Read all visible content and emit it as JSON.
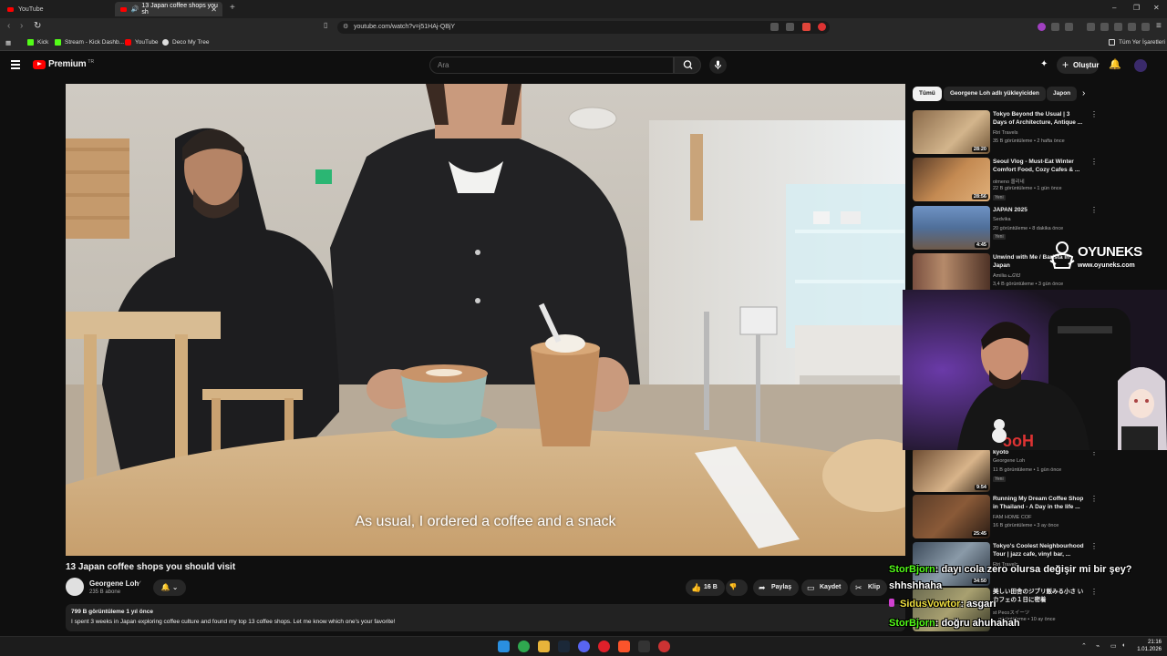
{
  "browser": {
    "tabs": [
      {
        "label": "YouTube"
      },
      {
        "label": "13 Japan coffee shops you sh"
      }
    ],
    "new_tab": "+",
    "window_controls": {
      "minimize": "–",
      "maximize": "❐",
      "close": "✕"
    },
    "url": "youtube.com/watch?v=j51HAj-QBjY",
    "bookmarks": [
      {
        "label": "Kick",
        "color": "#53fc18"
      },
      {
        "label": "Stream - Kick Dashb...",
        "color": "#53fc18"
      },
      {
        "label": "YouTube",
        "color": "#ff0000"
      },
      {
        "label": "Deco My Tree",
        "color": "#dddddd"
      }
    ],
    "all_bookmarks": "Tüm Yer İşaretleri"
  },
  "youtube": {
    "logo_text": "Premium",
    "logo_region": "TR",
    "search_placeholder": "Ara",
    "create_label": "Oluştur",
    "create_icon": "+"
  },
  "video": {
    "subtitle": "As usual, I ordered a coffee and a snack",
    "title": "13 Japan coffee shops you should visit",
    "channel": "Georgene Loh",
    "verified_icon": "✓",
    "subscribers": "235 B abone",
    "bell": "🔔 ⌄",
    "likes": "16 B",
    "share": "Paylaş",
    "save": "Kaydet",
    "clip": "Klip",
    "description_meta": "799 B görüntüleme  1 yıl önce",
    "description": "I spent 3 weeks in Japan exploring coffee culture and found my top 13 coffee shops. Let me know which one's your favorite!"
  },
  "sidebar": {
    "chips": [
      "Tümü",
      "Georgene Loh adlı yükleyiciden",
      "Japon"
    ],
    "next_icon": "›",
    "recommendations": [
      {
        "title": "Tokyo Beyond the Usual | 3 Days of Architecture, Antique ...",
        "channel": "Riri Travels",
        "meta": "35 B görüntüleme • 2 hafta önce",
        "duration": "28:20",
        "badge": "",
        "thumb": "#8a6a4a"
      },
      {
        "title": "Seoul Vlog - Must-Eat Winter Comfort Food, Cozy Cafes & ...",
        "channel": "olmeno 올리네",
        "meta": "22 B görüntüleme • 1 gün önce",
        "duration": "28:56",
        "badge": "Yeni",
        "thumb": "#a97a4c"
      },
      {
        "title": "JAPAN 2025",
        "channel": "Sedvika",
        "meta": "20 görüntüleme • 8 dakika önce",
        "duration": "4:45",
        "badge": "Yeni",
        "thumb": "#4f6f9a"
      },
      {
        "title": "Unwind with Me / Barista in Japan",
        "channel": "Amilia ᓚᘏᗢ",
        "meta": "3,4 B görüntüleme • 3 gün önce",
        "duration": "",
        "badge": "",
        "thumb": "#7a5040"
      },
      {
        "title": "kyoto",
        "channel": "Georgene Loh",
        "meta": "11 B görüntüleme • 1 gün önce",
        "duration": "9:54",
        "badge": "Yeni",
        "thumb": "#6b4a30"
      },
      {
        "title": "Running My Dream Coffee Shop in Thailand - A Day in the life ...",
        "channel": "FAM HOME COF",
        "meta": "16 B görüntüleme • 3 ay önce",
        "duration": "25:45",
        "badge": "",
        "thumb": "#5a3c28"
      },
      {
        "title": "Tokyo's Coolest Neighbourhood Tour | jazz cafe, vinyl bar, ...",
        "channel": "Riri Travels",
        "meta": "",
        "duration": "34:50",
        "badge": "",
        "thumb": "#3c4a5a"
      },
      {
        "title": "美しい田舎のジブリ飯みる小さ いカフェの１日に密着",
        "channel": "st Pecoスイーツ",
        "meta": "... görüntüleme • 10 ay önce",
        "duration": "",
        "badge": "",
        "thumb": "#6a6a50"
      }
    ],
    "more_icon": "⋮"
  },
  "overlay": {
    "brand_name": "OYUNEKS",
    "brand_url": "www.oyuneks.com",
    "chat": [
      {
        "user": "StorBjorn",
        "message": ": dayı cola zero olursa değişir mi bir şey?",
        "color": "#53fc18"
      },
      {
        "user": "",
        "message": "shhshhaha",
        "color": "#ffffff"
      },
      {
        "user": "SidusVowtor",
        "message": ": asgari",
        "color": "#f0e040"
      },
      {
        "user": "StorBjorn",
        "message": ": doğru ahuhahah",
        "color": "#53fc18"
      }
    ]
  },
  "taskbar": {
    "time": "21:16",
    "date": "1.01.2026"
  }
}
